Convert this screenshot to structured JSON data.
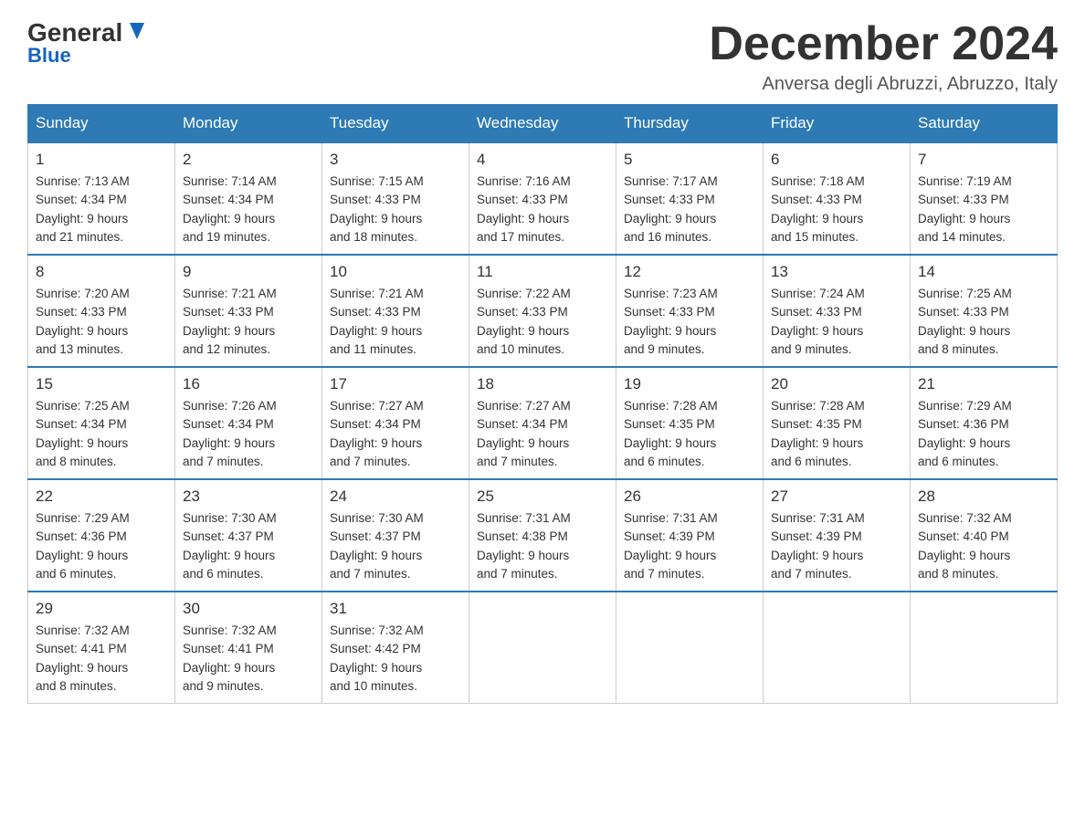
{
  "header": {
    "logo_top": "General",
    "logo_arrow": "▶",
    "logo_bottom": "Blue",
    "month_title": "December 2024",
    "subtitle": "Anversa degli Abruzzi, Abruzzo, Italy"
  },
  "days_of_week": [
    "Sunday",
    "Monday",
    "Tuesday",
    "Wednesday",
    "Thursday",
    "Friday",
    "Saturday"
  ],
  "weeks": [
    [
      {
        "day": "1",
        "sunrise": "7:13 AM",
        "sunset": "4:34 PM",
        "daylight": "9 hours and 21 minutes."
      },
      {
        "day": "2",
        "sunrise": "7:14 AM",
        "sunset": "4:34 PM",
        "daylight": "9 hours and 19 minutes."
      },
      {
        "day": "3",
        "sunrise": "7:15 AM",
        "sunset": "4:33 PM",
        "daylight": "9 hours and 18 minutes."
      },
      {
        "day": "4",
        "sunrise": "7:16 AM",
        "sunset": "4:33 PM",
        "daylight": "9 hours and 17 minutes."
      },
      {
        "day": "5",
        "sunrise": "7:17 AM",
        "sunset": "4:33 PM",
        "daylight": "9 hours and 16 minutes."
      },
      {
        "day": "6",
        "sunrise": "7:18 AM",
        "sunset": "4:33 PM",
        "daylight": "9 hours and 15 minutes."
      },
      {
        "day": "7",
        "sunrise": "7:19 AM",
        "sunset": "4:33 PM",
        "daylight": "9 hours and 14 minutes."
      }
    ],
    [
      {
        "day": "8",
        "sunrise": "7:20 AM",
        "sunset": "4:33 PM",
        "daylight": "9 hours and 13 minutes."
      },
      {
        "day": "9",
        "sunrise": "7:21 AM",
        "sunset": "4:33 PM",
        "daylight": "9 hours and 12 minutes."
      },
      {
        "day": "10",
        "sunrise": "7:21 AM",
        "sunset": "4:33 PM",
        "daylight": "9 hours and 11 minutes."
      },
      {
        "day": "11",
        "sunrise": "7:22 AM",
        "sunset": "4:33 PM",
        "daylight": "9 hours and 10 minutes."
      },
      {
        "day": "12",
        "sunrise": "7:23 AM",
        "sunset": "4:33 PM",
        "daylight": "9 hours and 9 minutes."
      },
      {
        "day": "13",
        "sunrise": "7:24 AM",
        "sunset": "4:33 PM",
        "daylight": "9 hours and 9 minutes."
      },
      {
        "day": "14",
        "sunrise": "7:25 AM",
        "sunset": "4:33 PM",
        "daylight": "9 hours and 8 minutes."
      }
    ],
    [
      {
        "day": "15",
        "sunrise": "7:25 AM",
        "sunset": "4:34 PM",
        "daylight": "9 hours and 8 minutes."
      },
      {
        "day": "16",
        "sunrise": "7:26 AM",
        "sunset": "4:34 PM",
        "daylight": "9 hours and 7 minutes."
      },
      {
        "day": "17",
        "sunrise": "7:27 AM",
        "sunset": "4:34 PM",
        "daylight": "9 hours and 7 minutes."
      },
      {
        "day": "18",
        "sunrise": "7:27 AM",
        "sunset": "4:34 PM",
        "daylight": "9 hours and 7 minutes."
      },
      {
        "day": "19",
        "sunrise": "7:28 AM",
        "sunset": "4:35 PM",
        "daylight": "9 hours and 6 minutes."
      },
      {
        "day": "20",
        "sunrise": "7:28 AM",
        "sunset": "4:35 PM",
        "daylight": "9 hours and 6 minutes."
      },
      {
        "day": "21",
        "sunrise": "7:29 AM",
        "sunset": "4:36 PM",
        "daylight": "9 hours and 6 minutes."
      }
    ],
    [
      {
        "day": "22",
        "sunrise": "7:29 AM",
        "sunset": "4:36 PM",
        "daylight": "9 hours and 6 minutes."
      },
      {
        "day": "23",
        "sunrise": "7:30 AM",
        "sunset": "4:37 PM",
        "daylight": "9 hours and 6 minutes."
      },
      {
        "day": "24",
        "sunrise": "7:30 AM",
        "sunset": "4:37 PM",
        "daylight": "9 hours and 7 minutes."
      },
      {
        "day": "25",
        "sunrise": "7:31 AM",
        "sunset": "4:38 PM",
        "daylight": "9 hours and 7 minutes."
      },
      {
        "day": "26",
        "sunrise": "7:31 AM",
        "sunset": "4:39 PM",
        "daylight": "9 hours and 7 minutes."
      },
      {
        "day": "27",
        "sunrise": "7:31 AM",
        "sunset": "4:39 PM",
        "daylight": "9 hours and 7 minutes."
      },
      {
        "day": "28",
        "sunrise": "7:32 AM",
        "sunset": "4:40 PM",
        "daylight": "9 hours and 8 minutes."
      }
    ],
    [
      {
        "day": "29",
        "sunrise": "7:32 AM",
        "sunset": "4:41 PM",
        "daylight": "9 hours and 8 minutes."
      },
      {
        "day": "30",
        "sunrise": "7:32 AM",
        "sunset": "4:41 PM",
        "daylight": "9 hours and 9 minutes."
      },
      {
        "day": "31",
        "sunrise": "7:32 AM",
        "sunset": "4:42 PM",
        "daylight": "9 hours and 10 minutes."
      },
      null,
      null,
      null,
      null
    ]
  ],
  "labels": {
    "sunrise": "Sunrise:",
    "sunset": "Sunset:",
    "daylight": "Daylight:"
  }
}
